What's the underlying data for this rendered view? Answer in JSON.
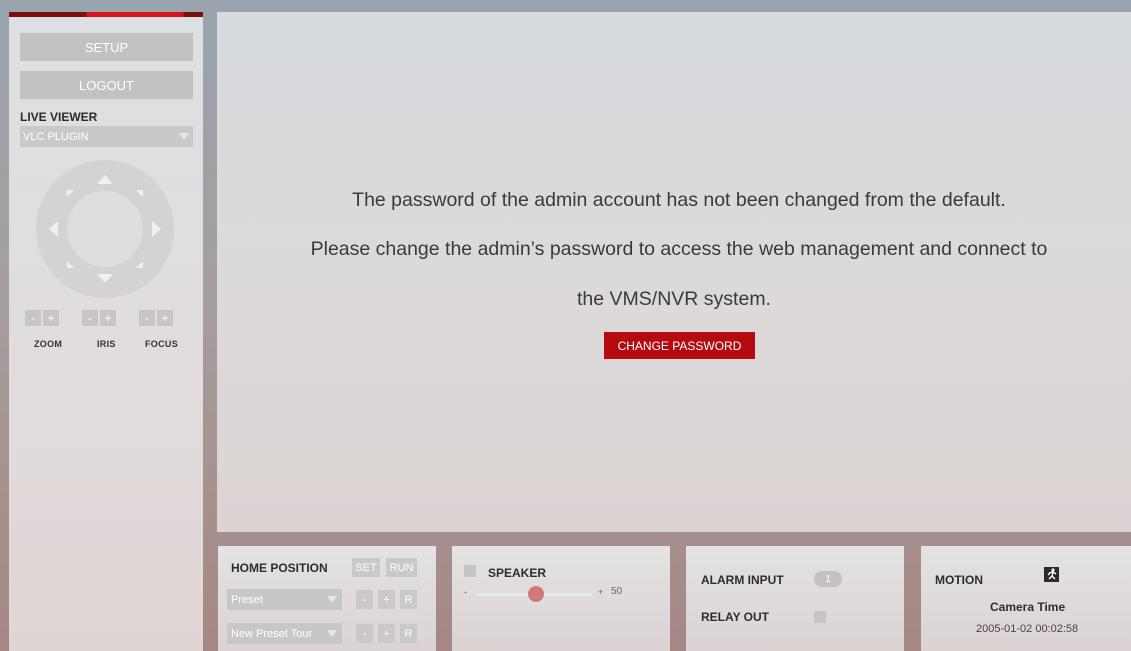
{
  "sidebar": {
    "setup_label": "SETUP",
    "logout_label": "LOGOUT",
    "live_viewer_title": "LIVE VIEWER",
    "live_viewer_selected": "VLC PLUGIN",
    "ptz_controls": [
      {
        "label": "ZOOM",
        "minus": "-",
        "plus": "+"
      },
      {
        "label": "IRIS",
        "minus": "-",
        "plus": "+"
      },
      {
        "label": "FOCUS",
        "minus": "-",
        "plus": "+"
      }
    ]
  },
  "viewer": {
    "message_line1": "The password of the admin account has not been changed from the default.",
    "message_line2": "Please change the admin’s password to access the web management and connect to",
    "message_line3": "the VMS/NVR system.",
    "change_password_label": "CHANGE PASSWORD"
  },
  "home_position": {
    "title": "HOME POSITION",
    "set_label": "SET",
    "run_label": "RUN",
    "preset_selected": "Preset",
    "preset_tour_selected": "New Preset Tour",
    "minus": "-",
    "plus": "+",
    "r": "R"
  },
  "speaker": {
    "title": "SPEAKER",
    "min_label": "-",
    "max_label": "+",
    "volume_value": "50",
    "volume_level": 50
  },
  "alarm": {
    "alarm_input_label": "ALARM INPUT",
    "alarm_input_count": "1",
    "relay_out_label": "RELAY OUT"
  },
  "status": {
    "motion_label": "MOTION",
    "camera_time_label": "Camera Time",
    "camera_time_value": "2005-01-02 00:02:58"
  },
  "colors": {
    "accent_red": "#b50b10",
    "button_gray": "#c2c2c2",
    "slider_knob": "#d27a7a"
  }
}
